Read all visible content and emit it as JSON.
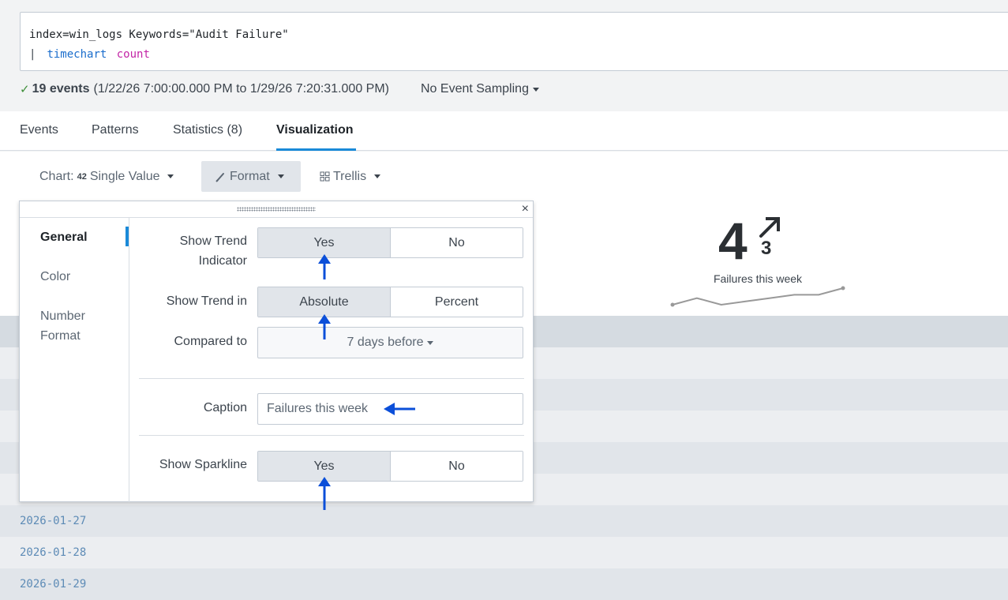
{
  "search": {
    "line1": "index=win_logs Keywords=\"Audit Failure\"",
    "pipe": "|",
    "command": "timechart",
    "function": "count"
  },
  "status": {
    "check": "✓",
    "events": "19 events",
    "range": "(1/22/26 7:00:00.000 PM to 1/29/26 7:20:31.000 PM)",
    "sampling": "No Event Sampling"
  },
  "tabs": [
    {
      "label": "Events"
    },
    {
      "label": "Patterns"
    },
    {
      "label": "Statistics (8)"
    },
    {
      "label": "Visualization",
      "active": true
    }
  ],
  "toolbar": {
    "chart_prefix": "Chart:",
    "chart_icon_text": "42",
    "chart_type": "Single Value",
    "format": "Format",
    "trellis": "Trellis"
  },
  "single_value": {
    "value": "4",
    "trend_value": "3",
    "trend_direction": "up",
    "caption": "Failures this week",
    "sparkline": [
      1,
      3,
      1,
      2,
      3,
      4,
      4,
      6
    ]
  },
  "format_panel": {
    "close": "×",
    "nav": [
      "General",
      "Color",
      "Number Format"
    ],
    "active_nav": "General",
    "show_trend_label": "Show Trend Indicator",
    "show_trend_options": [
      "Yes",
      "No"
    ],
    "show_trend_selected": "Yes",
    "trend_in_label": "Show Trend in",
    "trend_in_options": [
      "Absolute",
      "Percent"
    ],
    "trend_in_selected": "Absolute",
    "compared_label": "Compared to",
    "compared_value": "7 days before",
    "caption_label": "Caption",
    "caption_value": "Failures this week",
    "sparkline_label": "Show Sparkline",
    "sparkline_options": [
      "Yes",
      "No"
    ],
    "sparkline_selected": "Yes"
  },
  "table_rows": [
    "",
    "",
    "",
    "",
    "",
    "",
    "2026-01-27",
    "2026-01-28",
    "2026-01-29"
  ],
  "colors": {
    "accent": "#1a8ad8",
    "annotation_arrow": "#0b4fd9",
    "check": "#3f8f3a"
  }
}
